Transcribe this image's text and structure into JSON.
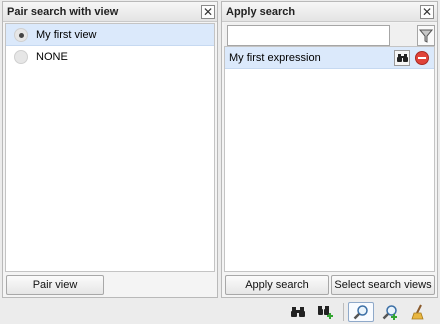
{
  "left_panel": {
    "title": "Pair search with view",
    "items": [
      {
        "label": "My first view",
        "checked": true
      },
      {
        "label": "NONE",
        "checked": false
      }
    ],
    "pair_button": "Pair view"
  },
  "right_panel": {
    "title": "Apply search",
    "search_value": "",
    "expressions": [
      {
        "label": "My first expression"
      }
    ],
    "apply_button": "Apply search",
    "select_views_button": "Select search views"
  },
  "toolbar": {
    "icons": [
      "binoculars-icon",
      "add-search-icon",
      "zoom-icon",
      "zoom-in-icon",
      "broom-icon"
    ]
  },
  "colors": {
    "selection": "#dbe9fb",
    "delete_red": "#e0433a",
    "add_green": "#33a532"
  }
}
